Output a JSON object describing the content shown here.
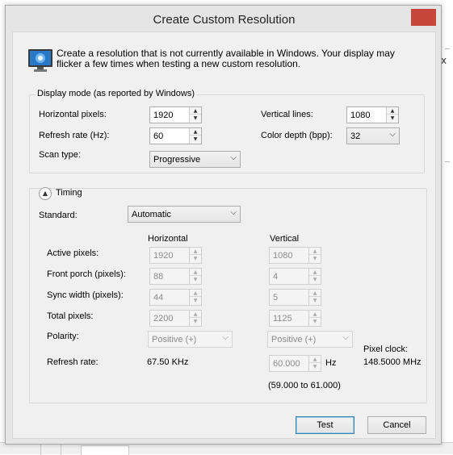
{
  "dialog": {
    "title": "Create Custom Resolution",
    "close_glyph": "✕",
    "intro_text": "Create a resolution that is not currently available in Windows. Your display may flicker a few times when testing a new custom resolution."
  },
  "background": {
    "partial_char": "x",
    "partial_tab_text": ""
  },
  "display_mode": {
    "group_label": "Display mode (as reported by Windows)",
    "horizontal_pixels_label": "Horizontal pixels:",
    "horizontal_pixels_value": "1920",
    "vertical_lines_label": "Vertical lines:",
    "vertical_lines_value": "1080",
    "refresh_rate_label": "Refresh rate (Hz):",
    "refresh_rate_value": "60",
    "color_depth_label": "Color depth (bpp):",
    "color_depth_value": "32",
    "scan_type_label": "Scan type:",
    "scan_type_value": "Progressive"
  },
  "timing": {
    "label": "Timing",
    "standard_label": "Standard:",
    "standard_value": "Automatic",
    "col_horizontal": "Horizontal",
    "col_vertical": "Vertical",
    "rows": {
      "active": {
        "label": "Active pixels:",
        "h": "1920",
        "v": "1080"
      },
      "front_porch": {
        "label": "Front porch (pixels):",
        "h": "88",
        "v": "4"
      },
      "sync_width": {
        "label": "Sync width (pixels):",
        "h": "44",
        "v": "5"
      },
      "total": {
        "label": "Total pixels:",
        "h": "2200",
        "v": "1125"
      }
    },
    "polarity_label": "Polarity:",
    "polarity_h": "Positive (+)",
    "polarity_v": "Positive (+)",
    "refresh_label": "Refresh rate:",
    "refresh_h": "67.50 KHz",
    "refresh_v": "60.000",
    "refresh_v_unit": "Hz",
    "refresh_range": "(59.000 to 61.000)",
    "pixel_clock_label": "Pixel clock:",
    "pixel_clock_value": "148.5000 MHz"
  },
  "buttons": {
    "test": "Test",
    "cancel": "Cancel"
  },
  "icons": {
    "spin_up": "▲",
    "spin_down": "▼",
    "dropdown": "⌵",
    "expander": "▲"
  },
  "colors": {
    "close_button": "#c7463c",
    "default_button_border": "#3c7fb1"
  }
}
